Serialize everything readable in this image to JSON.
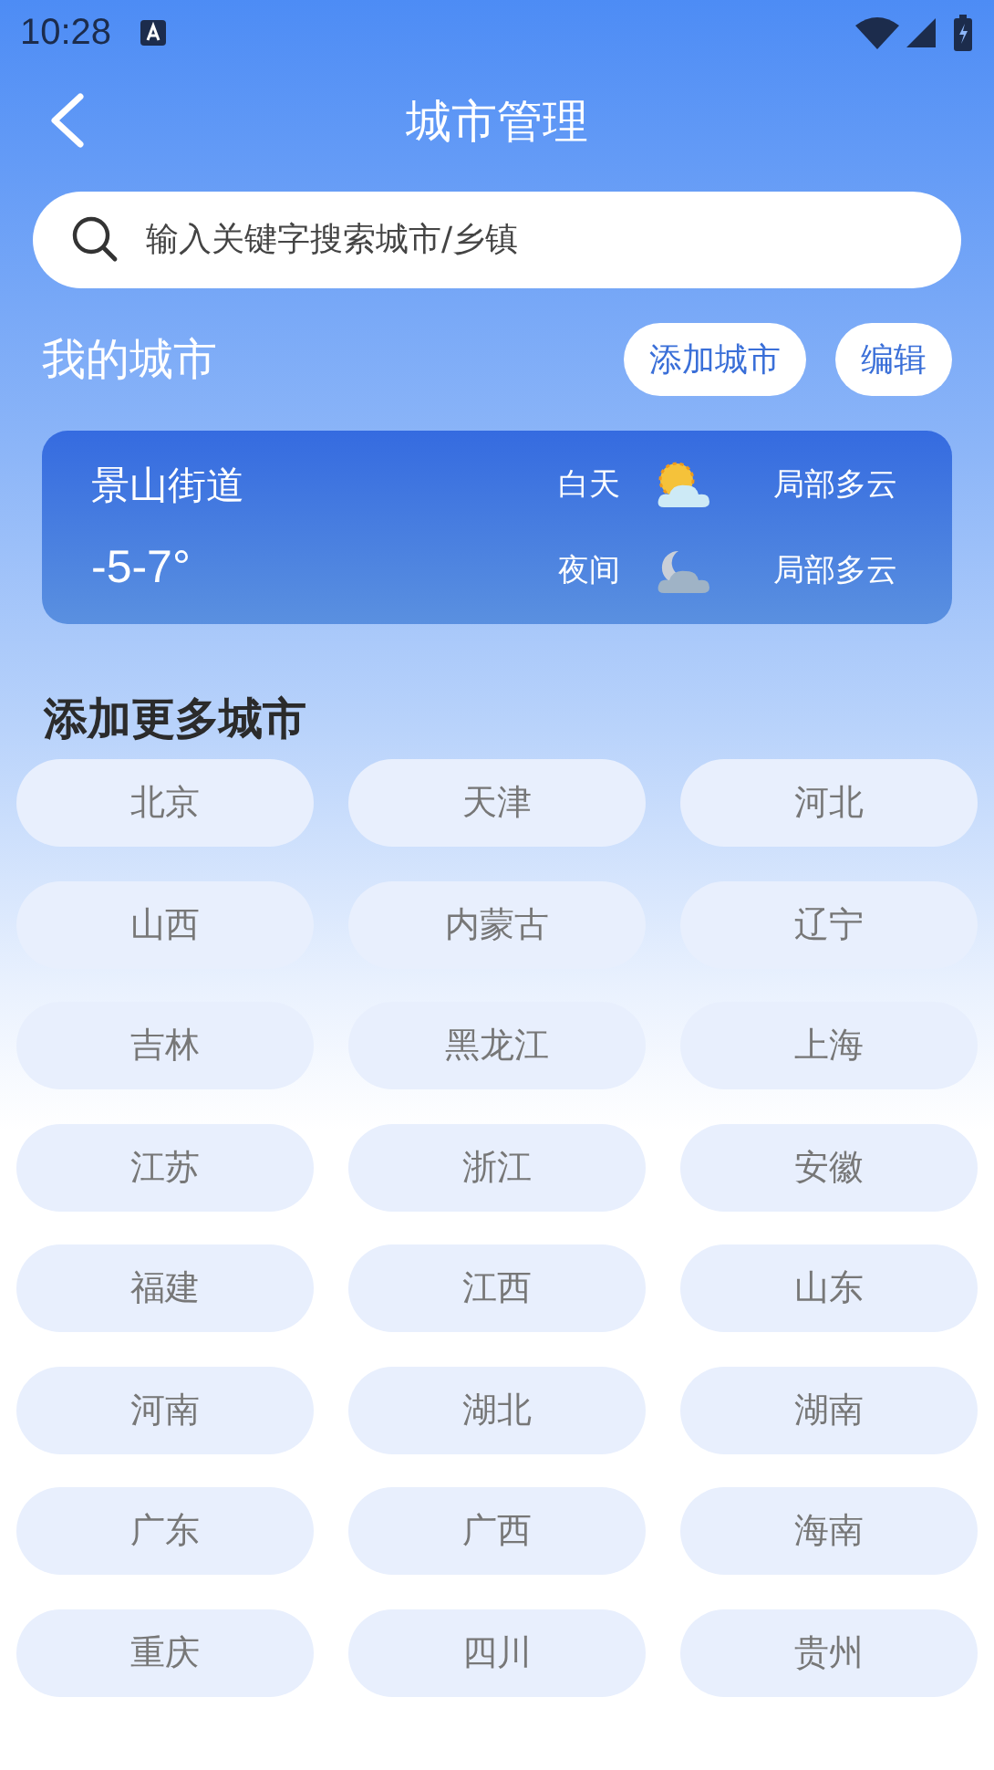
{
  "status_bar": {
    "time": "10:28"
  },
  "header": {
    "title": "城市管理"
  },
  "search": {
    "placeholder": "输入关键字搜索城市/乡镇"
  },
  "my_cities": {
    "title": "我的城市",
    "buttons": [
      "添加城市",
      "编辑"
    ],
    "cards": [
      {
        "name": "景山街道",
        "temperature": "-5-7°",
        "periods": [
          {
            "label": "白天",
            "kind": "day",
            "condition": "局部多云"
          },
          {
            "label": "夜间",
            "kind": "night",
            "condition": "局部多云"
          }
        ]
      }
    ]
  },
  "more_cities": {
    "title": "添加更多城市",
    "items": [
      "北京",
      "天津",
      "河北",
      "山西",
      "内蒙古",
      "辽宁",
      "吉林",
      "黑龙江",
      "上海",
      "江苏",
      "浙江",
      "安徽",
      "福建",
      "江西",
      "山东",
      "河南",
      "湖北",
      "湖南",
      "广东",
      "广西",
      "海南",
      "重庆",
      "四川",
      "贵州"
    ]
  }
}
